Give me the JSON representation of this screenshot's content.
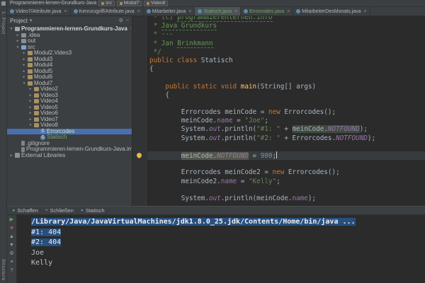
{
  "nav": {
    "project_name": "Programmieren-lernen-Grundkurs-Java",
    "crumbs": [
      "src",
      "Modul7",
      "Video8"
    ]
  },
  "tool_buttons": {
    "top": "1: Project",
    "bottom": "Structure"
  },
  "tabs": [
    {
      "label": "Video7/Attribute.java",
      "green": false,
      "active": false
    },
    {
      "label": "Kennzugriff/Attribute.java",
      "green": false,
      "active": false
    },
    {
      "label": "Mitarbeiter.java",
      "green": false,
      "active": false
    },
    {
      "label": "Statisch.java",
      "green": true,
      "active": true
    },
    {
      "label": "Errorcodes.java",
      "green": true,
      "active": false
    },
    {
      "label": "MitarbeiterDesMonats.java",
      "green": false,
      "active": false
    }
  ],
  "project_panel": {
    "title": "Project",
    "caret": "▾",
    "header_icons": [
      {
        "name": "gear",
        "glyph": "⚙"
      },
      {
        "name": "collapse-all",
        "glyph": "−"
      }
    ],
    "tree": [
      {
        "level": 0,
        "arrow": "down",
        "icon": "project",
        "label": "Programmieren-lernen-Grundkurs-Java",
        "extra": "~/IdeaProjects/Pro...",
        "bold": true
      },
      {
        "level": 1,
        "arrow": "right",
        "icon": "folder",
        "label": ".idea"
      },
      {
        "level": 1,
        "arrow": "right",
        "icon": "folder",
        "label": "out"
      },
      {
        "level": 1,
        "arrow": "down",
        "icon": "src",
        "label": "src"
      },
      {
        "level": 2,
        "arrow": "right",
        "icon": "pkg",
        "label": "Modul2.Video3"
      },
      {
        "level": 2,
        "arrow": "right",
        "icon": "pkg",
        "label": "Modul3"
      },
      {
        "level": 2,
        "arrow": "right",
        "icon": "pkg",
        "label": "Modul4"
      },
      {
        "level": 2,
        "arrow": "right",
        "icon": "pkg",
        "label": "Modul5"
      },
      {
        "level": 2,
        "arrow": "right",
        "icon": "pkg",
        "label": "Modul6"
      },
      {
        "level": 2,
        "arrow": "down",
        "icon": "pkg",
        "label": "Modul7"
      },
      {
        "level": 3,
        "arrow": "right",
        "icon": "pkg",
        "label": "Video2"
      },
      {
        "level": 3,
        "arrow": "right",
        "icon": "pkg",
        "label": "Video3"
      },
      {
        "level": 3,
        "arrow": "right",
        "icon": "pkg",
        "label": "Video4"
      },
      {
        "level": 3,
        "arrow": "right",
        "icon": "pkg",
        "label": "Video5"
      },
      {
        "level": 3,
        "arrow": "right",
        "icon": "pkg",
        "label": "Video6"
      },
      {
        "level": 3,
        "arrow": "right",
        "icon": "pkg",
        "label": "Video7"
      },
      {
        "level": 3,
        "arrow": "down",
        "icon": "pkg",
        "label": "Video8"
      },
      {
        "level": 4,
        "arrow": null,
        "icon": "class",
        "label": "Errorcodes",
        "green": true,
        "selected": true
      },
      {
        "level": 4,
        "arrow": null,
        "icon": "class",
        "label": "Statisch",
        "green": true
      },
      {
        "level": 1,
        "arrow": null,
        "icon": "file",
        "label": ".gitignore"
      },
      {
        "level": 1,
        "arrow": null,
        "icon": "file",
        "label": "Programmieren-lernen-Grundkurs-Java.iml"
      },
      {
        "level": 0,
        "arrow": "right",
        "icon": "lib",
        "label": "External Libraries"
      }
    ]
  },
  "editor": {
    "lines": [
      {
        "tok": [
          {
            "t": " * (c) ",
            "c": "cmt"
          },
          {
            "t": "programmierenlernen.info",
            "c": "cmt typo"
          }
        ]
      },
      {
        "tok": [
          {
            "t": " * ",
            "c": "cmt"
          },
          {
            "t": "Java Grundkurs",
            "c": "cmt typo"
          }
        ]
      },
      {
        "tok": [
          {
            "t": " * ---",
            "c": "cmt"
          }
        ]
      },
      {
        "tok": [
          {
            "t": " * Jan ",
            "c": "cmt"
          },
          {
            "t": "Brinkmann",
            "c": "cmt typo"
          }
        ]
      },
      {
        "tok": [
          {
            "t": " */",
            "c": "cmt"
          }
        ]
      },
      {
        "tok": [
          {
            "t": "public class ",
            "c": "kw"
          },
          {
            "t": "Statisch",
            "c": "pln"
          }
        ]
      },
      {
        "tok": [
          {
            "t": "{",
            "c": "pln"
          }
        ]
      },
      {
        "tok": []
      },
      {
        "tok": [
          {
            "t": "    ",
            "c": "pln"
          },
          {
            "t": "public static void ",
            "c": "kw"
          },
          {
            "t": "main",
            "c": "mth"
          },
          {
            "t": "(String[] args)",
            "c": "pln"
          }
        ]
      },
      {
        "tok": [
          {
            "t": "    {",
            "c": "pln"
          }
        ]
      },
      {
        "tok": []
      },
      {
        "tok": [
          {
            "t": "        Errorcodes meinCode = ",
            "c": "pln"
          },
          {
            "t": "new ",
            "c": "kw"
          },
          {
            "t": "Errorcodes();",
            "c": "pln"
          }
        ]
      },
      {
        "tok": [
          {
            "t": "        meinCode.",
            "c": "pln"
          },
          {
            "t": "name",
            "c": "fld"
          },
          {
            "t": " = ",
            "c": "pln"
          },
          {
            "t": "\"Joe\"",
            "c": "str"
          },
          {
            "t": ";",
            "c": "pln"
          }
        ]
      },
      {
        "tok": [
          {
            "t": "        System.",
            "c": "pln"
          },
          {
            "t": "out",
            "c": "sf"
          },
          {
            "t": ".println(",
            "c": "pln"
          },
          {
            "t": "\"#1: \"",
            "c": "str"
          },
          {
            "t": " + ",
            "c": "pln"
          },
          {
            "t": "meinCode.",
            "c": "pln hlr"
          },
          {
            "t": "NOTFOUND",
            "c": "sf hlr"
          },
          {
            "t": ");",
            "c": "pln"
          }
        ]
      },
      {
        "tok": [
          {
            "t": "        System.",
            "c": "pln"
          },
          {
            "t": "out",
            "c": "sf"
          },
          {
            "t": ".println(",
            "c": "pln"
          },
          {
            "t": "\"#2: \"",
            "c": "str"
          },
          {
            "t": " + Errorcodes.",
            "c": "pln"
          },
          {
            "t": "NOTFOUND",
            "c": "sf"
          },
          {
            "t": ");",
            "c": "pln"
          }
        ]
      },
      {
        "tok": []
      },
      {
        "hl": true,
        "bulb": true,
        "caret": true,
        "tok": [
          {
            "t": "        ",
            "c": "pln"
          },
          {
            "t": "meinCode.",
            "c": "pln hlw"
          },
          {
            "t": "NOTFOUND",
            "c": "sf hlw"
          },
          {
            "t": " = ",
            "c": "pln"
          },
          {
            "t": "900",
            "c": "num"
          },
          {
            "t": ";",
            "c": "pln"
          }
        ]
      },
      {
        "tok": []
      },
      {
        "tok": [
          {
            "t": "        Errorcodes meinCode2 = ",
            "c": "pln"
          },
          {
            "t": "new ",
            "c": "kw"
          },
          {
            "t": "Errorcodes();",
            "c": "pln"
          }
        ]
      },
      {
        "tok": [
          {
            "t": "        meinCode2.",
            "c": "pln"
          },
          {
            "t": "name",
            "c": "fld"
          },
          {
            "t": " = ",
            "c": "pln"
          },
          {
            "t": "\"Kelly\"",
            "c": "str"
          },
          {
            "t": ";",
            "c": "pln"
          }
        ]
      },
      {
        "tok": []
      },
      {
        "tok": [
          {
            "t": "        System.",
            "c": "pln"
          },
          {
            "t": "out",
            "c": "sf"
          },
          {
            "t": ".println(meinCode.",
            "c": "pln"
          },
          {
            "t": "name",
            "c": "fld"
          },
          {
            "t": ");",
            "c": "pln"
          }
        ]
      }
    ]
  },
  "run_panel": {
    "header_items": [
      {
        "label": "Schaffen",
        "icon": "run",
        "glyph": "▸",
        "color": "#6fae6f"
      },
      {
        "label": "Schließen",
        "icon": "close",
        "glyph": "×",
        "color": "#9aa0a3"
      },
      {
        "label": "Statisch",
        "icon": "class",
        "glyph": "●",
        "color": "#5c8aab"
      }
    ],
    "toolbar": [
      {
        "name": "rerun",
        "glyph": "▶",
        "color": "#66a35c"
      },
      {
        "name": "stop",
        "glyph": "■",
        "color": "#9a5a55"
      },
      {
        "name": "up",
        "glyph": "▲",
        "color": "#9aa0a3"
      },
      {
        "name": "down",
        "glyph": "▼",
        "color": "#9aa0a3"
      },
      {
        "name": "settings",
        "glyph": "⚙",
        "color": "#9aa0a3"
      },
      {
        "name": "pin",
        "glyph": "≡",
        "color": "#9aa0a3"
      },
      {
        "name": "help",
        "glyph": "?",
        "color": "#9aa0a3"
      }
    ],
    "console": [
      {
        "text": "/Library/Java/JavaVirtualMachines/jdk1.8.0_25.jdk/Contents/Home/bin/java ...",
        "selected": true,
        "bold": true
      },
      {
        "text": "#1: 404",
        "selected": true,
        "bold": false
      },
      {
        "text": "#2: 404",
        "selected": true,
        "bold": false
      },
      {
        "text": "Joe",
        "selected": false,
        "bold": false
      },
      {
        "text": "Kelly",
        "selected": false,
        "bold": false
      }
    ]
  }
}
